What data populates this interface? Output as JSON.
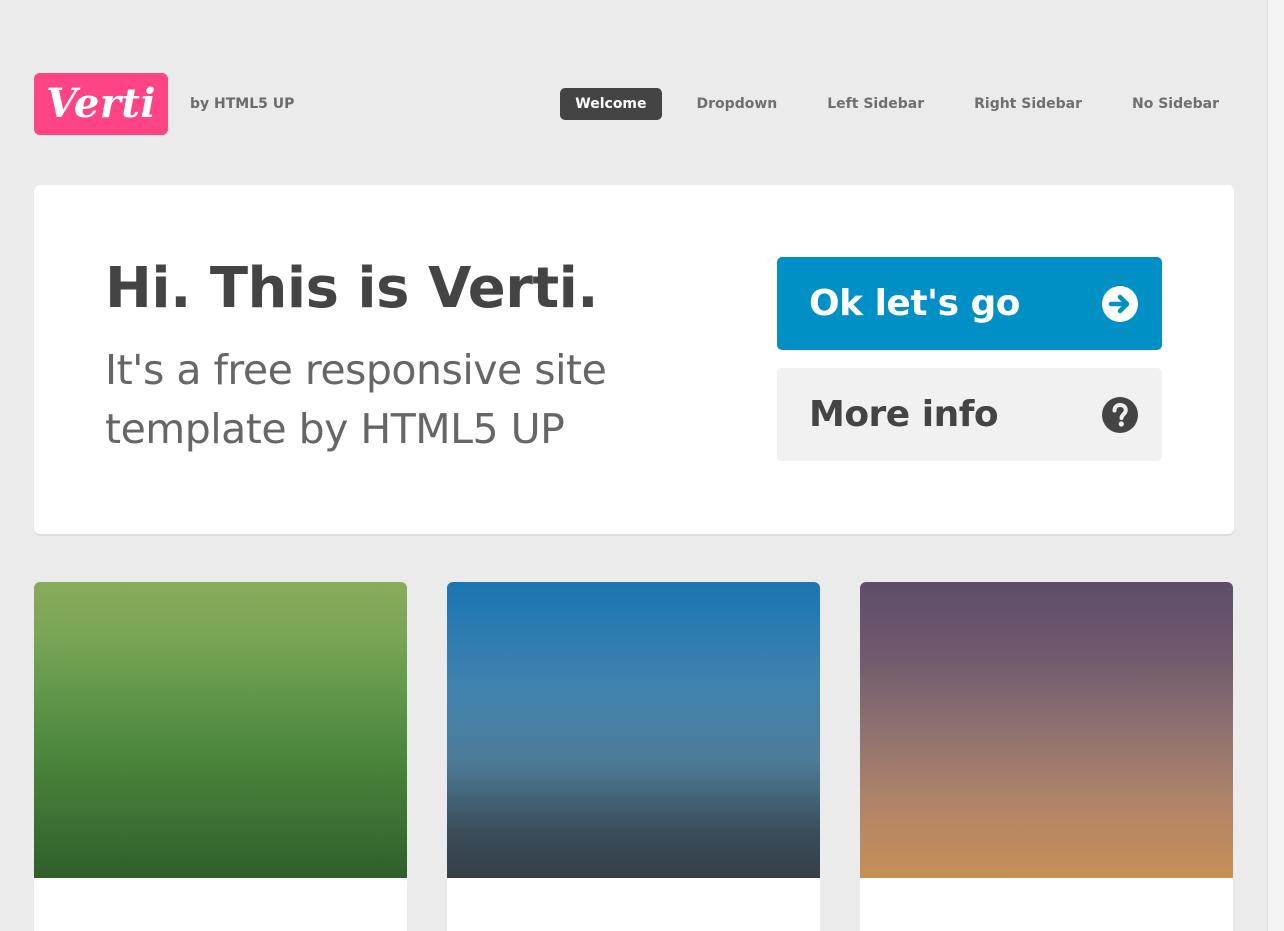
{
  "header": {
    "logo_text": "Verti",
    "tagline": "by HTML5 UP",
    "brand_color": "#ff4486"
  },
  "nav": {
    "items": [
      {
        "label": "Welcome",
        "active": true
      },
      {
        "label": "Dropdown",
        "active": false
      },
      {
        "label": "Left Sidebar",
        "active": false
      },
      {
        "label": "Right Sidebar",
        "active": false
      },
      {
        "label": "No Sidebar",
        "active": false
      }
    ]
  },
  "banner": {
    "title": "Hi. This is Verti.",
    "subtitle": "It's a free responsive site template by HTML5 UP",
    "primary_button": {
      "label": "Ok let's go",
      "icon": "arrow-right-circle-icon",
      "color": "#0090c5"
    },
    "secondary_button": {
      "label": "More info",
      "icon": "question-circle-icon",
      "color": "#f1f1f1"
    }
  },
  "features": {
    "cards": [
      {
        "image": "green-landscape-image"
      },
      {
        "image": "blue-sky-image"
      },
      {
        "image": "sunset-sky-image"
      }
    ]
  }
}
